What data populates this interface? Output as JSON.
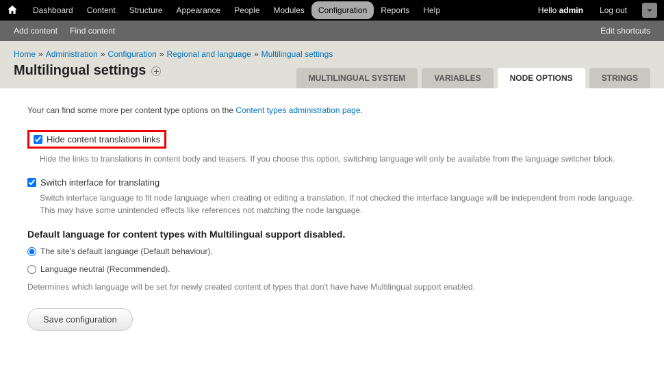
{
  "toolbar": {
    "menu": [
      "Dashboard",
      "Content",
      "Structure",
      "Appearance",
      "People",
      "Modules",
      "Configuration",
      "Reports",
      "Help"
    ],
    "active_index": 6,
    "hello_prefix": "Hello ",
    "username": "admin",
    "logout": "Log out"
  },
  "shortcuts": {
    "add_content": "Add content",
    "find_content": "Find content",
    "edit": "Edit shortcuts"
  },
  "breadcrumb": {
    "items": [
      "Home",
      "Administration",
      "Configuration",
      "Regional and language",
      "Multilingual settings"
    ]
  },
  "page_title": "Multilingual settings",
  "tabs": {
    "items": [
      "Multilingual system",
      "Variables",
      "Node options",
      "Strings"
    ],
    "active_index": 2
  },
  "intro": {
    "prefix": "Your can find some more per content type options on the ",
    "link": "Content types administration page",
    "suffix": "."
  },
  "form": {
    "hide_links": {
      "label": "Hide content translation links",
      "desc": "Hide the links to translations in content body and teasers. If you choose this option, switching language will only be available from the language switcher block.",
      "checked": true
    },
    "switch_interface": {
      "label": "Switch interface for translating",
      "desc": "Switch interface language to fit node language when creating or editing a translation. If not checked the interface language will be independent from node language. This may have some unintended effects like references not matching the node language.",
      "checked": true
    },
    "default_lang": {
      "title": "Default language for content types with Multilingual support disabled.",
      "option1": "The site's default language (Default behaviour).",
      "option2": "Language neutral (Recommended).",
      "help": "Determines which language will be set for newly created content of types that don't have have Multilingual support enabled.",
      "selected": 0
    },
    "save_label": "Save configuration"
  }
}
